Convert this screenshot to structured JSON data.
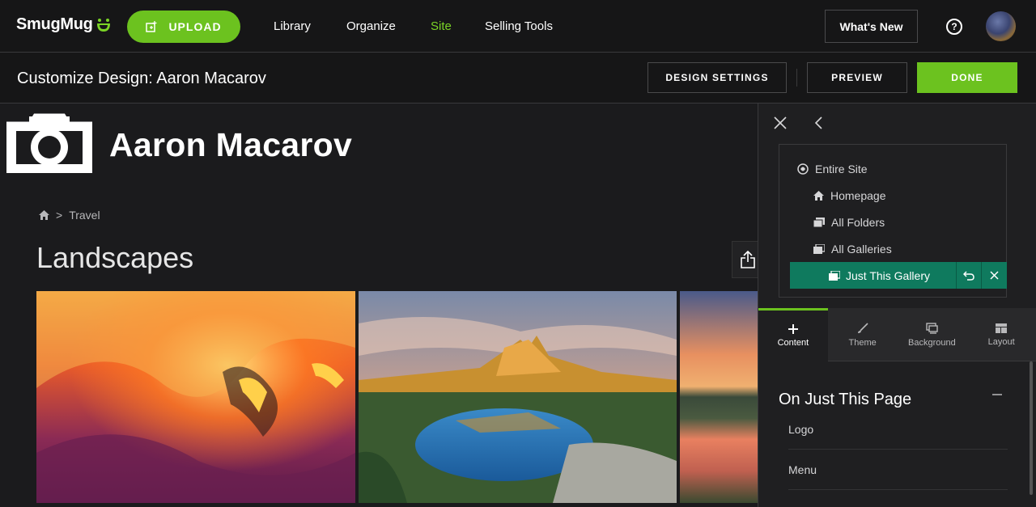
{
  "nav": {
    "brand": "SmugMug",
    "upload_label": "UPLOAD",
    "links": [
      "Library",
      "Organize",
      "Site",
      "Selling Tools"
    ],
    "active_link": "Site",
    "whats_new": "What's New",
    "help_label": "?"
  },
  "subbar": {
    "title": "Customize Design: Aaron Macarov",
    "design_settings": "DESIGN SETTINGS",
    "preview": "PREVIEW",
    "done": "DONE"
  },
  "preview": {
    "site_name": "Aaron Macarov",
    "breadcrumb": "Travel",
    "breadcrumb_sep": ">",
    "gallery_title": "Landscapes"
  },
  "panel": {
    "scope": {
      "entire_site": "Entire Site",
      "homepage": "Homepage",
      "all_folders": "All Folders",
      "all_galleries": "All Galleries",
      "just_this_gallery": "Just This Gallery"
    },
    "tabs": [
      {
        "label": "Content",
        "icon": "plus-icon"
      },
      {
        "label": "Theme",
        "icon": "brush-icon"
      },
      {
        "label": "Background",
        "icon": "monitor-icon"
      },
      {
        "label": "Layout",
        "icon": "layout-icon"
      }
    ],
    "active_tab": "Content",
    "section_title": "On Just This Page",
    "items": [
      "Logo",
      "Menu"
    ]
  },
  "colors": {
    "accent_green": "#6cc21f",
    "active_teal": "#0f7a5e",
    "background": "#1b1b1d"
  }
}
